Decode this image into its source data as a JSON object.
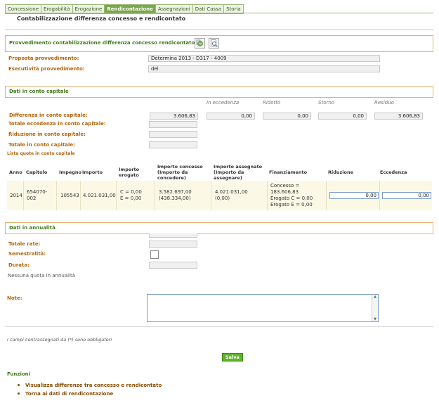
{
  "tabs": [
    "Concessione",
    "Erogabilità",
    "Erogazione",
    "Rendicontazione",
    "Assegnazioni",
    "Dati Cassa",
    "Storia"
  ],
  "active_tab": "Rendicontazione",
  "page_title": "Contabilizzazione differenza concesso e rendicontato",
  "provvedimento": {
    "section_title": "Provvedimento contabilizzazione differenza concesso rendicontato (*)",
    "proposta_label": "Proposta provvedimento:",
    "proposta_value": "Determina 2013 - D317 - 4009",
    "esecutivita_label": "Esecutività provvedimento:",
    "esecutivita_value": "del"
  },
  "conto_capitale": {
    "section_title": "Dati in conto capitale",
    "col_headers": [
      "In eccedenza",
      "Ridotto",
      "Storno",
      "Residuo"
    ],
    "differenza_label": "Differenza in conto capitale:",
    "differenza_values": [
      "3.606,83",
      "0,00",
      "0,00",
      "0,00",
      "3.606,83"
    ],
    "totale_eccedenza_label": "Totale eccedenza in conto capitale:",
    "riduzione_label": "Riduzione in conto capitale:",
    "totale_label": "Totale in conto capitale:",
    "lista_label": "Lista quote in conto capitale"
  },
  "table": {
    "headers": {
      "anno": "Anno",
      "capitolo": "Capitolo",
      "impegno": "Impegno",
      "importo": "Importo",
      "importo_erogato_1": "Importo",
      "importo_erogato_2": "erogato",
      "concesso_1": "Importo concesso",
      "concesso_2": "(Importo da",
      "concesso_3": "concedere)",
      "assegnato_1": "Importo assegnato",
      "assegnato_2": "(Importo da",
      "assegnato_3": "assegnare)",
      "finanziamento": "Finanziamento",
      "riduzione": "Riduzione",
      "eccedenza": "Eccedenza"
    },
    "row": {
      "anno": "2014",
      "capitolo_1": "654070-",
      "capitolo_2": "002",
      "impegno": "105543",
      "importo": "4.021.031,00",
      "erogato_c": "C = 0,00",
      "erogato_e": "E = 0,00",
      "concesso_1": "3.582.697,00",
      "concesso_2": "(438.334,00)",
      "assegnato_1": "4.021.031,00",
      "assegnato_2": "(0,00)",
      "fin_1": "Concesso =",
      "fin_2": "183.606,83",
      "fin_3": "Erogato C = 0,00",
      "fin_4": "Erogato E = 0,00",
      "riduzione": "0,00",
      "eccedenza": "0,00"
    }
  },
  "annualita": {
    "section_title": "Dati in annualità",
    "totale_rate_label": "Totale rate:",
    "semestralita_label": "Semestralità:",
    "durata_label": "Durata:",
    "nessuna": "Nessuna quota in annualità"
  },
  "note_label": "Note:",
  "obbligatori": "I campi contrassegnati da (*) sono obbligatori",
  "salva_label": "Salva",
  "funzioni": {
    "title": "Funzioni",
    "links": [
      "Visualizza differenze tra concesso e rendicontato",
      "Torna ai dati di rendicontazione"
    ]
  }
}
